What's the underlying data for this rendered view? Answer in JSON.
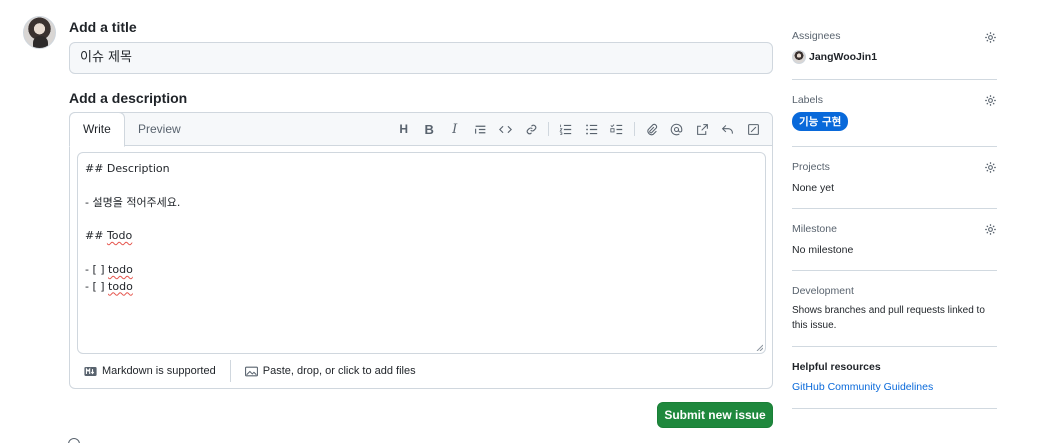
{
  "issue_form": {
    "title_label": "Add a title",
    "title_value": "이슈 제목",
    "description_label": "Add a description",
    "tabs": [
      {
        "label": "Write",
        "active": true
      },
      {
        "label": "Preview",
        "active": false
      }
    ],
    "toolbar": {
      "heading_glyph": "H",
      "bold_glyph": "B",
      "italic_glyph": "I",
      "icons": [
        "heading-icon",
        "bold-icon",
        "italic-icon",
        "quote-icon",
        "code-icon",
        "link-icon",
        "ordered-list-icon",
        "unordered-list-icon",
        "task-list-icon",
        "attach-icon",
        "mention-icon",
        "reference-icon",
        "reply-icon",
        "fullscreen-icon"
      ]
    },
    "description_lines": [
      "## Description",
      "",
      "- 설명을 적어주세요.",
      "",
      "## ",
      "",
      "- [ ] ",
      "- [ ] "
    ],
    "misspelled_words": [
      "Todo",
      "todo",
      "todo"
    ],
    "footer": {
      "markdown_text": "Markdown is supported",
      "attach_text": "Paste, drop, or click to add files"
    },
    "submit_label": "Submit new issue",
    "submit_color": "#1f883d"
  },
  "sidebar": {
    "assignees": {
      "heading": "Assignees",
      "user": "JangWooJin1"
    },
    "labels": {
      "heading": "Labels",
      "items": [
        {
          "name": "기능 구현",
          "color": "#0969da"
        }
      ]
    },
    "projects": {
      "heading": "Projects",
      "value": "None yet"
    },
    "milestone": {
      "heading": "Milestone",
      "value": "No milestone"
    },
    "development": {
      "heading": "Development",
      "text": "Shows branches and pull requests linked to this issue."
    },
    "helpful": {
      "heading": "Helpful resources",
      "link": "GitHub Community Guidelines"
    }
  }
}
